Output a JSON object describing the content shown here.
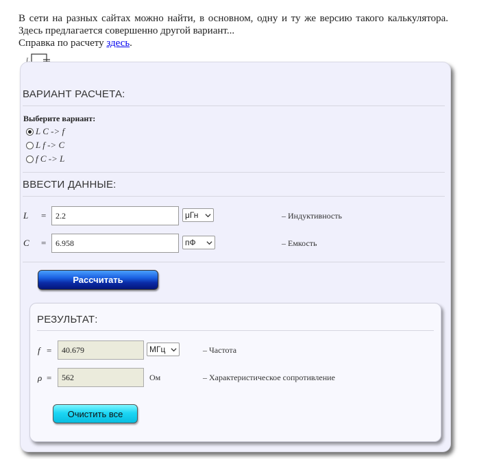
{
  "intro": {
    "line1": "В сети на разных сайтах можно найти, в основном, одну и ту же версию такого калькулятора. Здесь предлагается совершенно другой вариант...",
    "help_prefix": "Справка по расчету ",
    "help_link": "здесь",
    "help_suffix": "."
  },
  "schematic": {
    "label_l": "L",
    "label_c": "C"
  },
  "variant": {
    "title": "ВАРИАНТ РАСЧЕТА:",
    "choose_label": "Выберите вариант:",
    "options": [
      {
        "label": "L C -> f",
        "checked": true
      },
      {
        "label": "L f -> C",
        "checked": false
      },
      {
        "label": "f C -> L",
        "checked": false
      }
    ]
  },
  "input": {
    "title": "ВВЕСТИ ДАННЫЕ:",
    "L": {
      "symbol": "L",
      "eq": "=",
      "value": "2.2",
      "unit": "μГн",
      "desc": "– Индуктивность"
    },
    "C": {
      "symbol": "C",
      "eq": "=",
      "value": "6.958",
      "unit": "пФ",
      "desc": "– Емкость"
    },
    "calc_button": "Рассчитать"
  },
  "result": {
    "title": "РЕЗУЛЬТАТ:",
    "f": {
      "symbol": "f",
      "eq": "=",
      "value": "40.679",
      "unit": "МГц",
      "desc": "– Частота"
    },
    "rho": {
      "symbol": "ρ",
      "eq": "=",
      "value": "562",
      "unit": "Ом",
      "desc": "– Характеристическое сопротивление"
    },
    "clear_button": "Очистить все"
  }
}
